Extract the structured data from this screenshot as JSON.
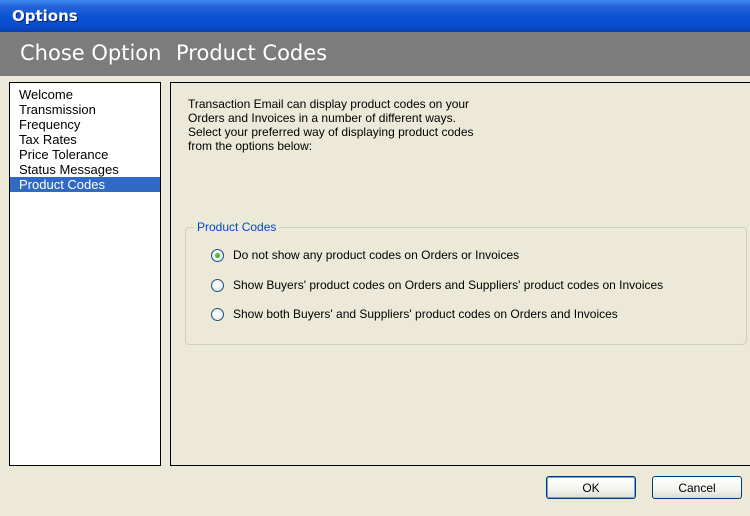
{
  "window": {
    "title": "Options"
  },
  "header": {
    "section": "Chose Option",
    "page": "Product Codes"
  },
  "nav": {
    "items": [
      {
        "label": "Welcome",
        "selected": false
      },
      {
        "label": "Transmission",
        "selected": false
      },
      {
        "label": "Frequency",
        "selected": false
      },
      {
        "label": "Tax Rates",
        "selected": false
      },
      {
        "label": "Price Tolerance",
        "selected": false
      },
      {
        "label": "Status Messages",
        "selected": false
      },
      {
        "label": "Product Codes",
        "selected": true
      }
    ]
  },
  "content": {
    "intro_lines": [
      "Transaction Email can display product codes on your",
      "Orders and Invoices in a number of different ways.",
      "Select your preferred way of displaying product codes",
      "from the options below:"
    ],
    "group": {
      "label": "Product Codes",
      "options": [
        {
          "label": "Do not show any product codes on Orders or Invoices",
          "checked": true
        },
        {
          "label": "Show Buyers' product codes on Orders and Suppliers' product codes on Invoices",
          "checked": false
        },
        {
          "label": "Show both Buyers' and Suppliers' product codes on Orders and Invoices",
          "checked": false
        }
      ]
    }
  },
  "buttons": {
    "ok": "OK",
    "cancel": "Cancel"
  },
  "colors": {
    "title_bar": "#0a52d6",
    "header_bar": "#7c7c7c",
    "selection": "#316ac5",
    "group_label": "#0046d5",
    "dialog_bg": "#ece9d8"
  }
}
